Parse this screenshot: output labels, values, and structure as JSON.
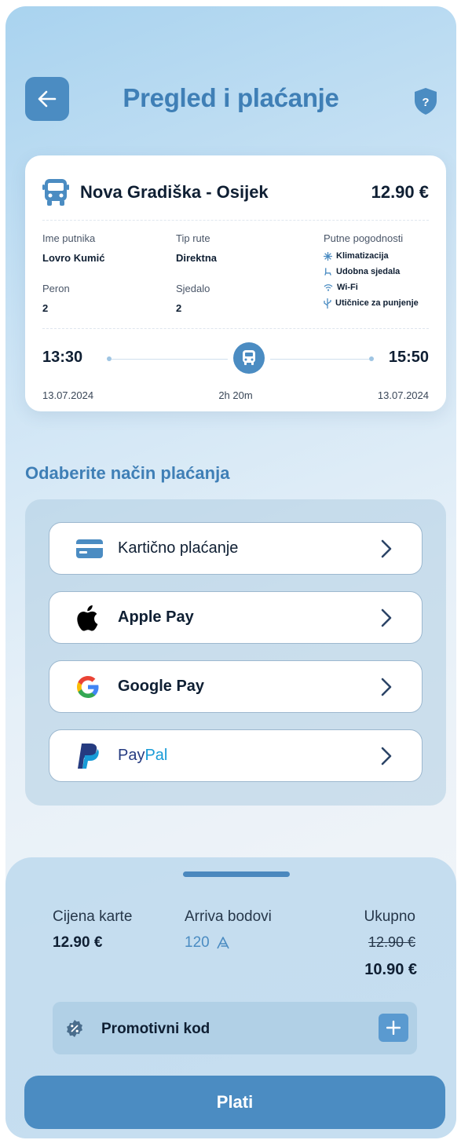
{
  "header": {
    "title": "Pregled i plaćanje"
  },
  "trip": {
    "route": "Nova Gradiška - Osijek",
    "price": "12.90 €",
    "passenger_label": "Ime putnika",
    "passenger_value": "Lovro Kumić",
    "route_type_label": "Tip rute",
    "route_type_value": "Direktna",
    "platform_label": "Peron",
    "platform_value": "2",
    "seat_label": "Sjedalo",
    "seat_value": "2",
    "amenities_label": "Putne pogodnosti",
    "amenities": [
      {
        "icon": "snowflake-icon",
        "label": "Klimatizacija"
      },
      {
        "icon": "seat-icon",
        "label": "Udobna sjedala"
      },
      {
        "icon": "wifi-icon",
        "label": "Wi-Fi"
      },
      {
        "icon": "usb-icon",
        "label": "Utičnice za punjenje"
      }
    ],
    "departure_time": "13:30",
    "arrival_time": "15:50",
    "departure_date": "13.07.2024",
    "arrival_date": "13.07.2024",
    "duration": "2h 20m"
  },
  "payment": {
    "section_title": "Odaberite način plaćanja",
    "methods": [
      {
        "label": "Kartično plaćanje",
        "icon": "card-icon"
      },
      {
        "label": "Apple Pay",
        "icon": "apple-icon"
      },
      {
        "label": "Google Pay",
        "icon": "google-icon"
      },
      {
        "label_part1": "Pay",
        "label_part2": "Pal",
        "icon": "paypal-icon"
      }
    ]
  },
  "summary": {
    "ticket_price_label": "Cijena karte",
    "ticket_price_value": "12.90 €",
    "points_label": "Arriva bodovi",
    "points_value": "120",
    "total_label": "Ukupno",
    "total_old": "12.90 €",
    "total_new": "10.90 €",
    "promo_label": "Promotivni kod",
    "pay_button": "Plati"
  },
  "colors": {
    "accent": "#4b8cc2",
    "title": "#3f7fb6",
    "paypal_dark": "#253b80",
    "paypal_light": "#179bd7"
  }
}
